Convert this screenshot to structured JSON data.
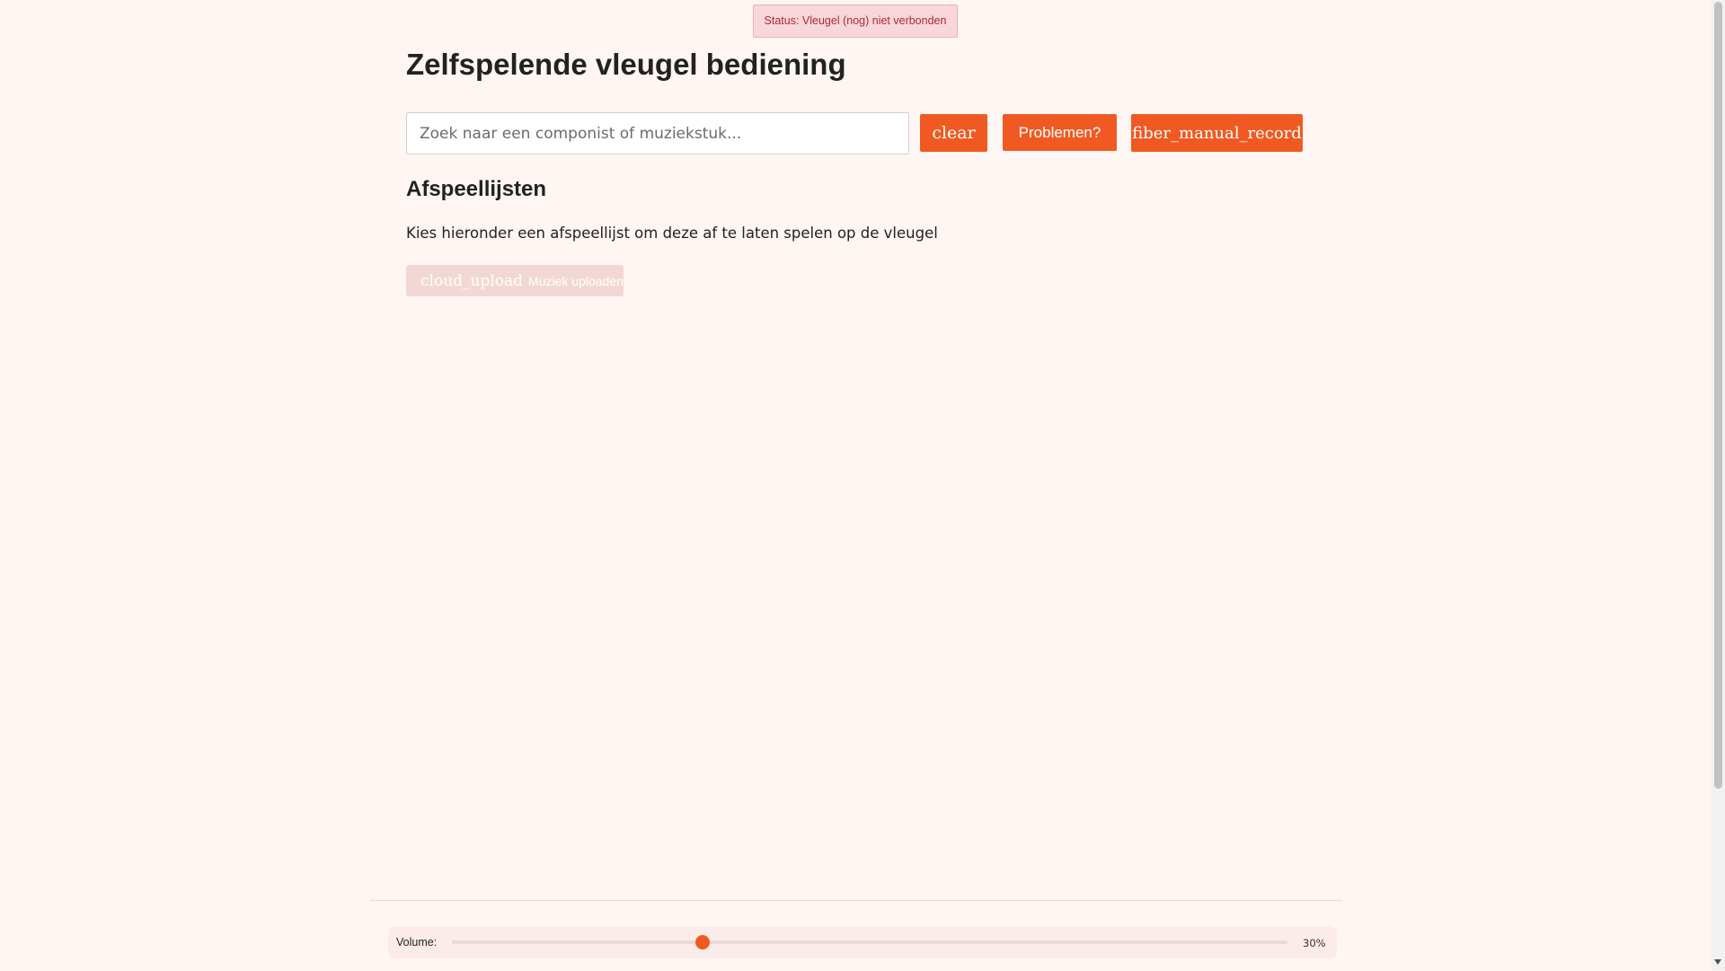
{
  "status": {
    "text": "Status: Vleugel (nog) niet verbonden",
    "color": "#b02a37",
    "background": "#f8d7da"
  },
  "header": {
    "title": "Zelfspelende vleugel bediening"
  },
  "search": {
    "value": "",
    "placeholder": "Zoek naar een componist of muziekstuk..."
  },
  "toolbar": {
    "clear_label": "clear",
    "problems_label": "Problemen?",
    "record_label": "fiber_manual_record",
    "accent_color": "#f05a22"
  },
  "playlists": {
    "title": "Afspeellijsten",
    "description": "Kies hieronder een afspeellijst om deze af te laten spelen op de vleugel",
    "upload_icon": "cloud_upload",
    "upload_label": "Muziek uploaden"
  },
  "volume": {
    "label": "Volume:",
    "value_text": "30%",
    "level": 0.3
  }
}
